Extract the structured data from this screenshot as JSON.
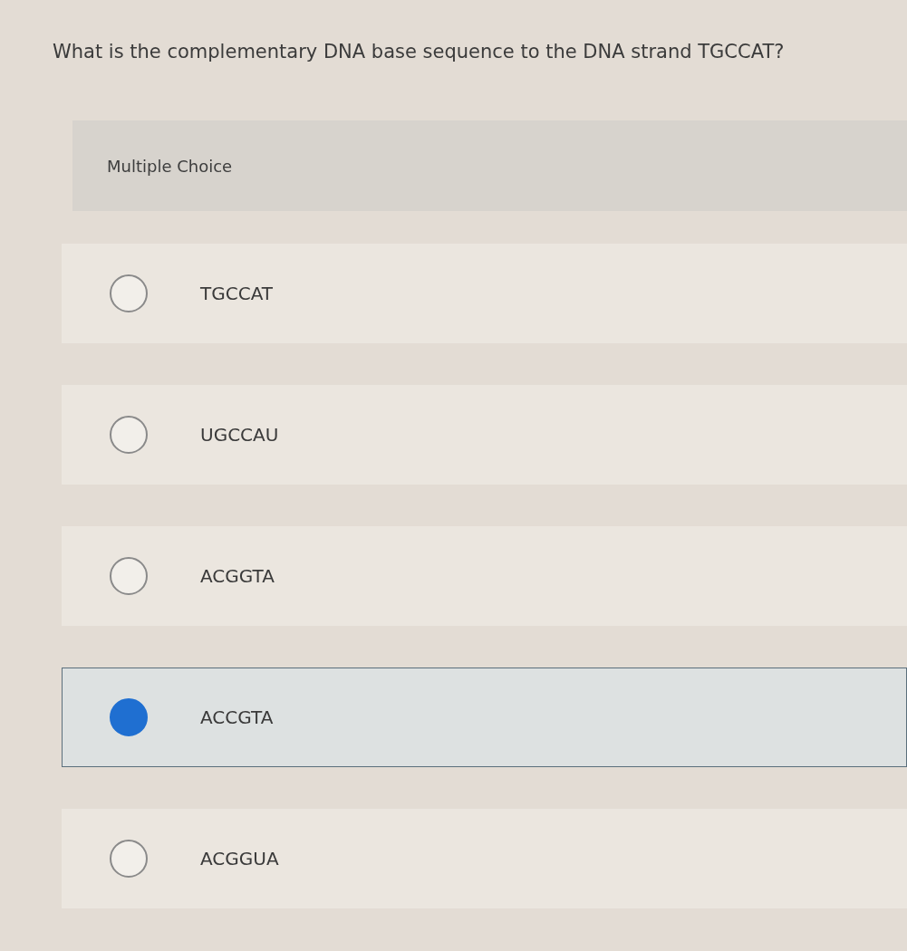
{
  "question": "What is the complementary DNA base sequence to the DNA strand TGCCAT?",
  "panel": {
    "title": "Multiple Choice"
  },
  "options": [
    {
      "label": "TGCCAT",
      "selected": false
    },
    {
      "label": "UGCCAU",
      "selected": false
    },
    {
      "label": "ACGGTA",
      "selected": false
    },
    {
      "label": "ACCGTA",
      "selected": true
    },
    {
      "label": "ACGGUA",
      "selected": false
    }
  ]
}
